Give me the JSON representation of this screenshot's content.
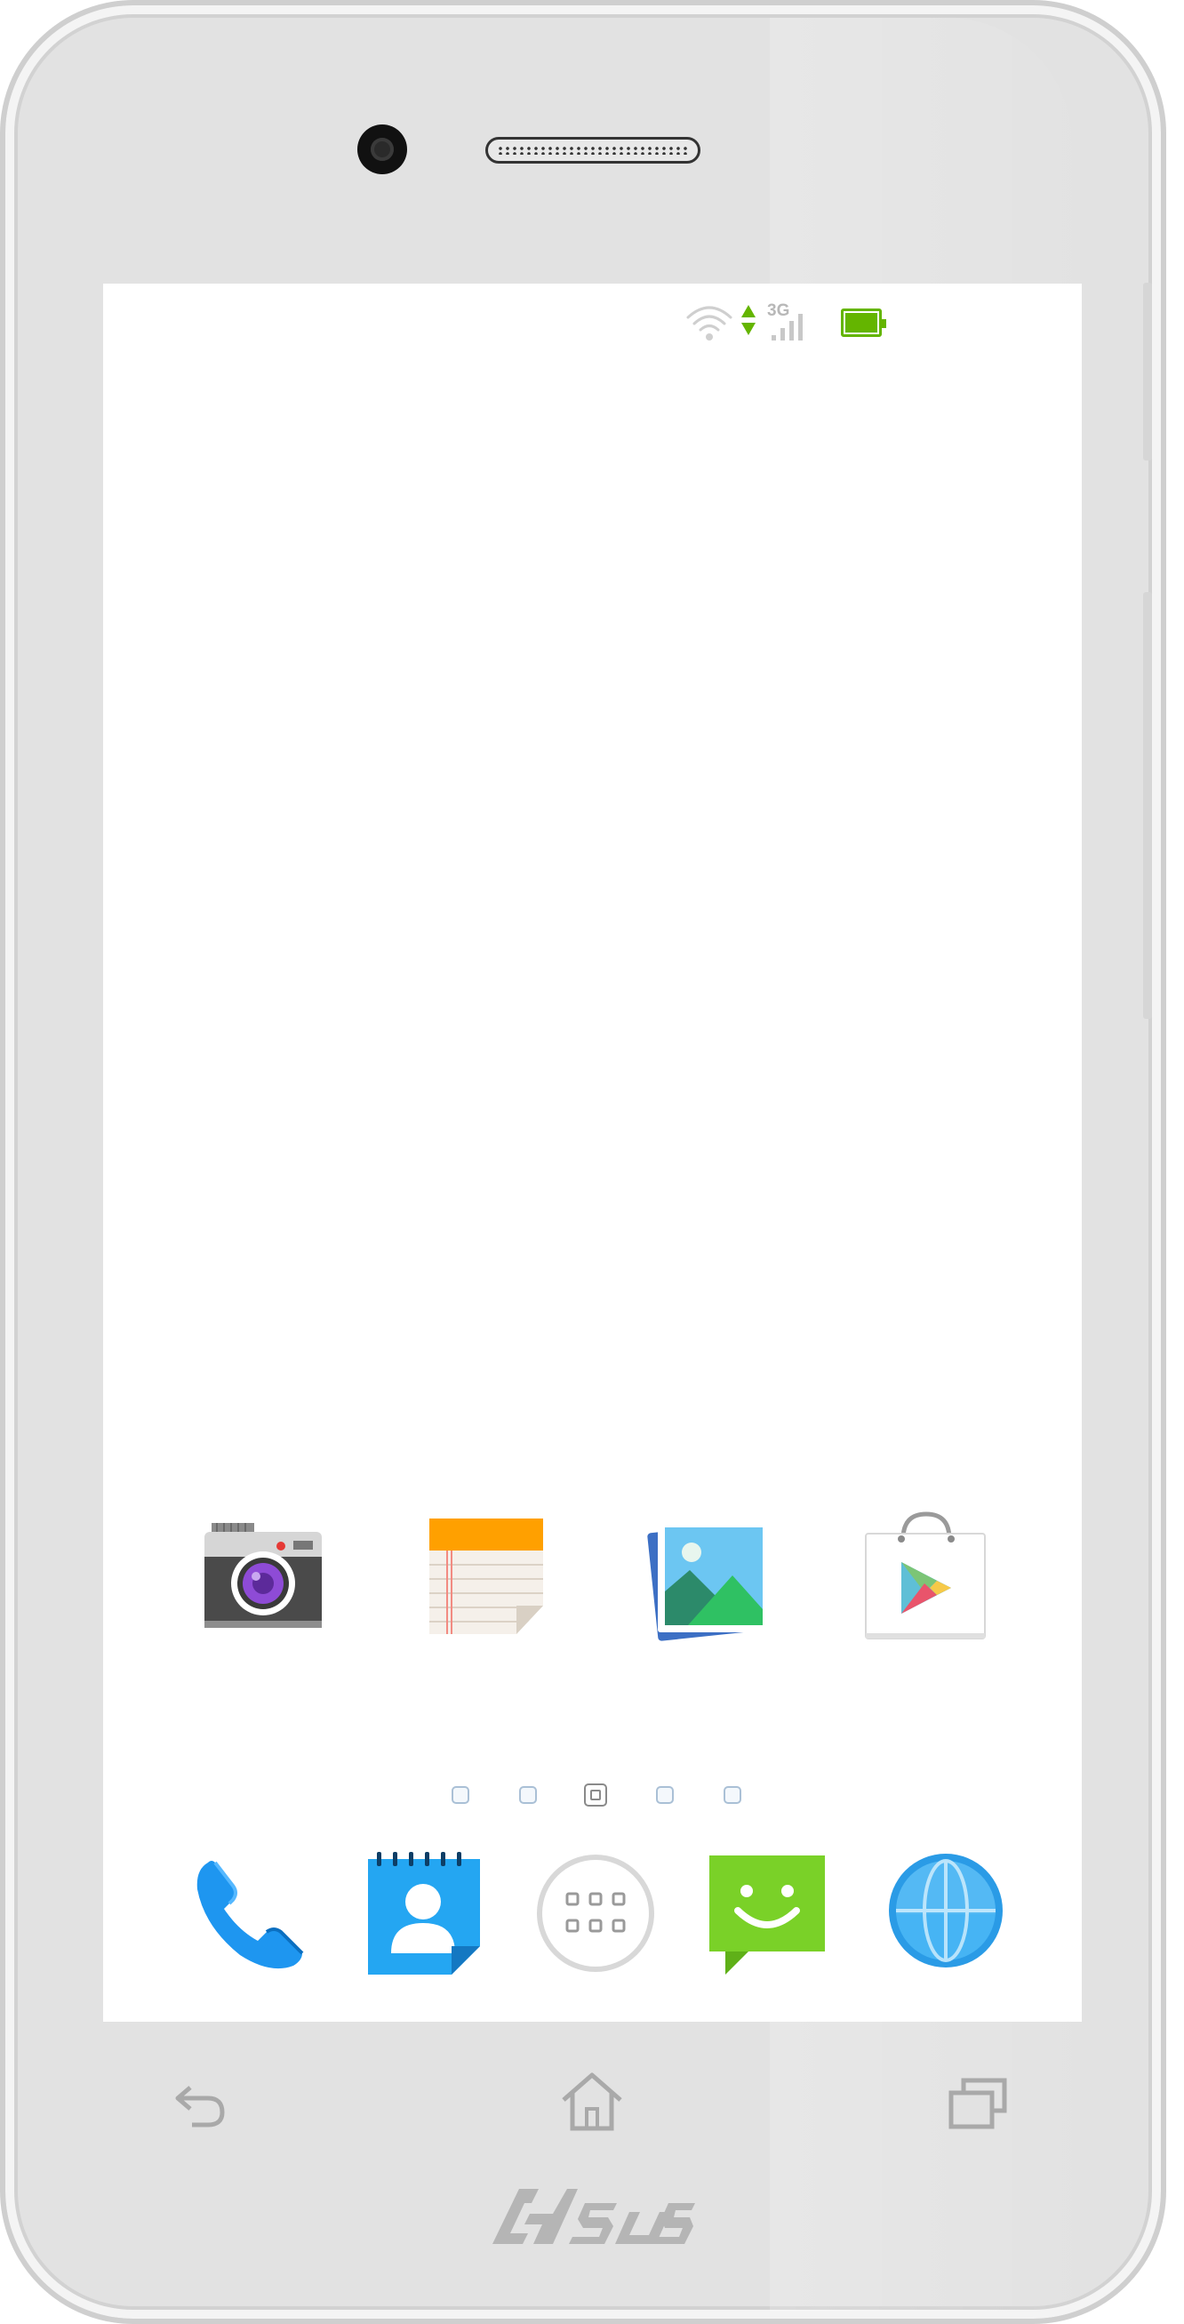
{
  "device": {
    "brand_logo": "ASUS"
  },
  "status_bar": {
    "network_label": "3G",
    "icons": [
      "wifi-icon",
      "data-arrows-icon",
      "signal-bars-icon",
      "battery-icon"
    ],
    "battery_color": "#64b500"
  },
  "home_apps": [
    {
      "icon": "camera-icon"
    },
    {
      "icon": "notes-icon"
    },
    {
      "icon": "gallery-icon"
    },
    {
      "icon": "play-store-icon"
    }
  ],
  "page_indicator": {
    "count": 5,
    "active_index": 2
  },
  "dock": [
    {
      "icon": "phone-icon"
    },
    {
      "icon": "contacts-icon"
    },
    {
      "icon": "app-drawer-icon"
    },
    {
      "icon": "messages-icon"
    },
    {
      "icon": "browser-icon"
    }
  ],
  "nav_keys": [
    "back-key-icon",
    "home-key-icon",
    "recents-key-icon"
  ],
  "colors": {
    "screen_bg": "#ffffff",
    "bezel": "#e2e2e2",
    "accent_blue": "#29a8f0",
    "accent_green": "#7ad128"
  }
}
